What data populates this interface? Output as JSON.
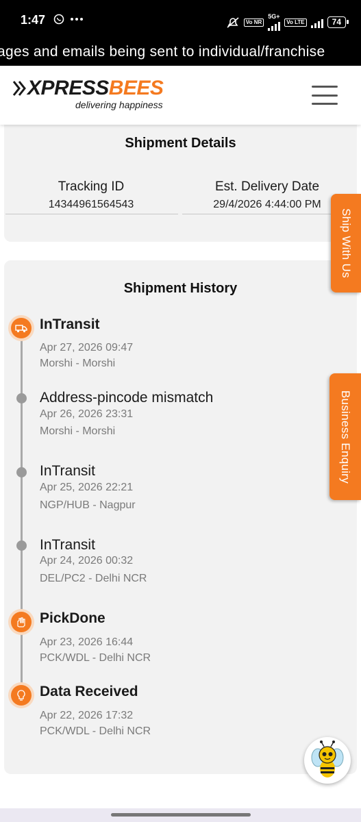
{
  "status_bar": {
    "time": "1:47",
    "network_5g": "5G+",
    "vo_tag_1": "Vo NR",
    "vo_tag_2": "Vo LTE",
    "battery": "74"
  },
  "ticker": {
    "text": "ages and emails being sent to individual/franchise"
  },
  "header": {
    "logo_x": "X",
    "logo_press": "PRESS",
    "logo_bees": "BEES",
    "logo_tagline": "delivering happiness"
  },
  "shipment_details": {
    "title": "Shipment Details",
    "tracking_label": "Tracking ID",
    "tracking_value": "14344961564543",
    "delivery_label": "Est. Delivery Date",
    "delivery_value": "29/4/2026 4:44:00 PM"
  },
  "shipment_history": {
    "title": "Shipment History",
    "events": [
      {
        "status": "InTransit",
        "date": "Apr 27, 2026 09:47",
        "location": "Morshi - Morshi"
      },
      {
        "status": "Address-pincode mismatch",
        "date": "Apr 26, 2026 23:31",
        "location": "Morshi - Morshi"
      },
      {
        "status": "InTransit",
        "date": "Apr 25, 2026 22:21",
        "location": "NGP/HUB - Nagpur"
      },
      {
        "status": "InTransit",
        "date": "Apr 24, 2026 00:32",
        "location": "DEL/PC2 - Delhi NCR"
      },
      {
        "status": "PickDone",
        "date": "Apr 23, 2026 16:44",
        "location": "PCK/WDL - Delhi NCR"
      },
      {
        "status": "Data Received",
        "date": "Apr 22, 2026 17:32",
        "location": "PCK/WDL - Delhi NCR"
      }
    ]
  },
  "side_tabs": {
    "ship": "Ship With Us",
    "business": "Business Enquiry"
  },
  "colors": {
    "brand_orange": "#f47a20",
    "card_bg": "#f2f2f2",
    "timeline_gray": "#a9a9a9"
  }
}
